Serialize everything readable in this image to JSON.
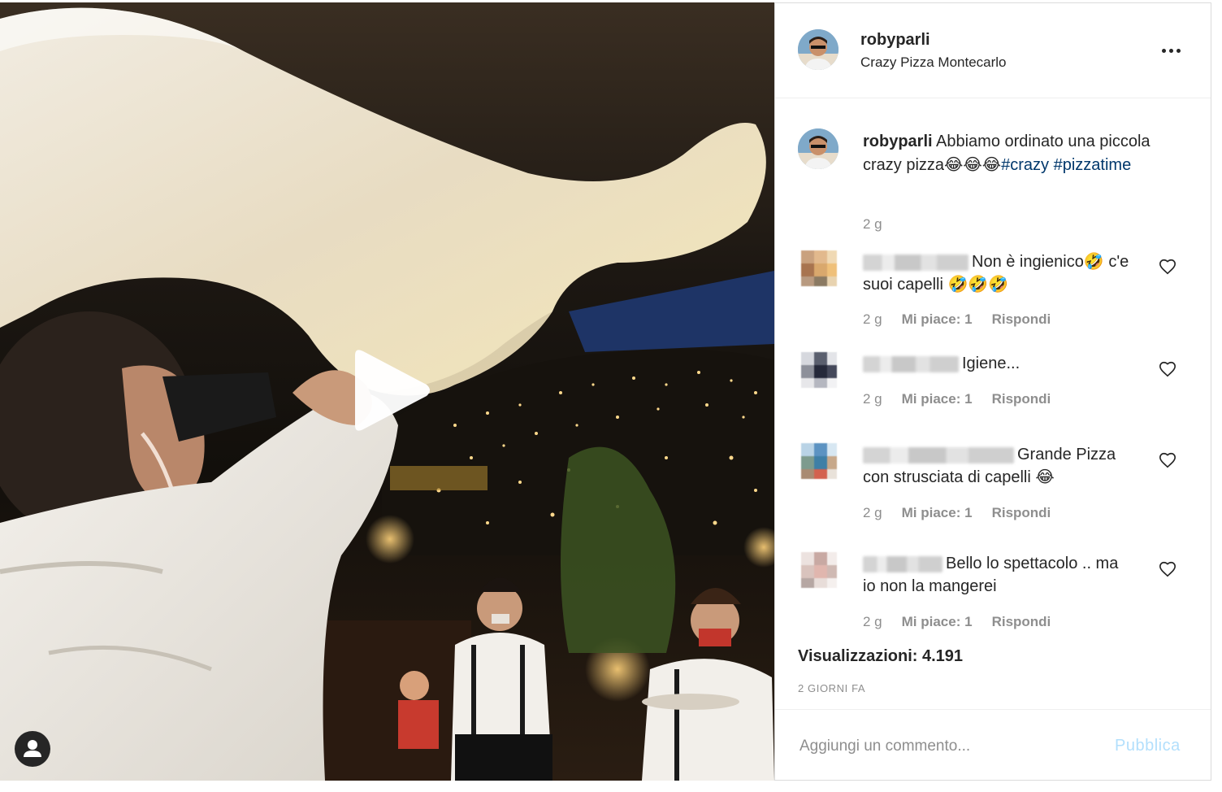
{
  "post": {
    "username": "robyparli",
    "location": "Crazy Pizza Montecarlo",
    "caption": {
      "username": "robyparli",
      "text": "Abbiamo ordinato una piccola crazy pizza😂😂😂",
      "hashtags": [
        "#crazy",
        "#pizzatime"
      ],
      "time": "2 g"
    },
    "comments": [
      {
        "text": "Non è ingienico🤣 c'e suoi capelli 🤣🤣🤣",
        "time": "2 g",
        "likes": "Mi piace: 1",
        "reply": "Rispondi"
      },
      {
        "text": "Igiene...",
        "time": "2 g",
        "likes": "Mi piace: 1",
        "reply": "Rispondi"
      },
      {
        "text": "Grande Pizza con strusciata di capelli 😂",
        "time": "2 g",
        "likes": "Mi piace: 1",
        "reply": "Rispondi"
      },
      {
        "text": "Bello lo spettacolo .. ma io non la mangerei",
        "time": "2 g",
        "likes": "Mi piace: 1",
        "reply": "Rispondi"
      }
    ],
    "views": "Visualizzazioni: 4.191",
    "date": "2 GIORNI FA",
    "add_comment": {
      "placeholder": "Aggiungi un commento...",
      "publish_label": "Pubblica"
    }
  },
  "icons": {
    "play": "play-icon",
    "user_tag": "user-icon",
    "more": "more-options-icon",
    "like": "heart-icon"
  },
  "colors": {
    "text": "#262626",
    "secondary": "#8e8e8e",
    "hashtag": "#00376b",
    "publish_disabled": "#b2dffc",
    "border": "#dbdbdb"
  }
}
